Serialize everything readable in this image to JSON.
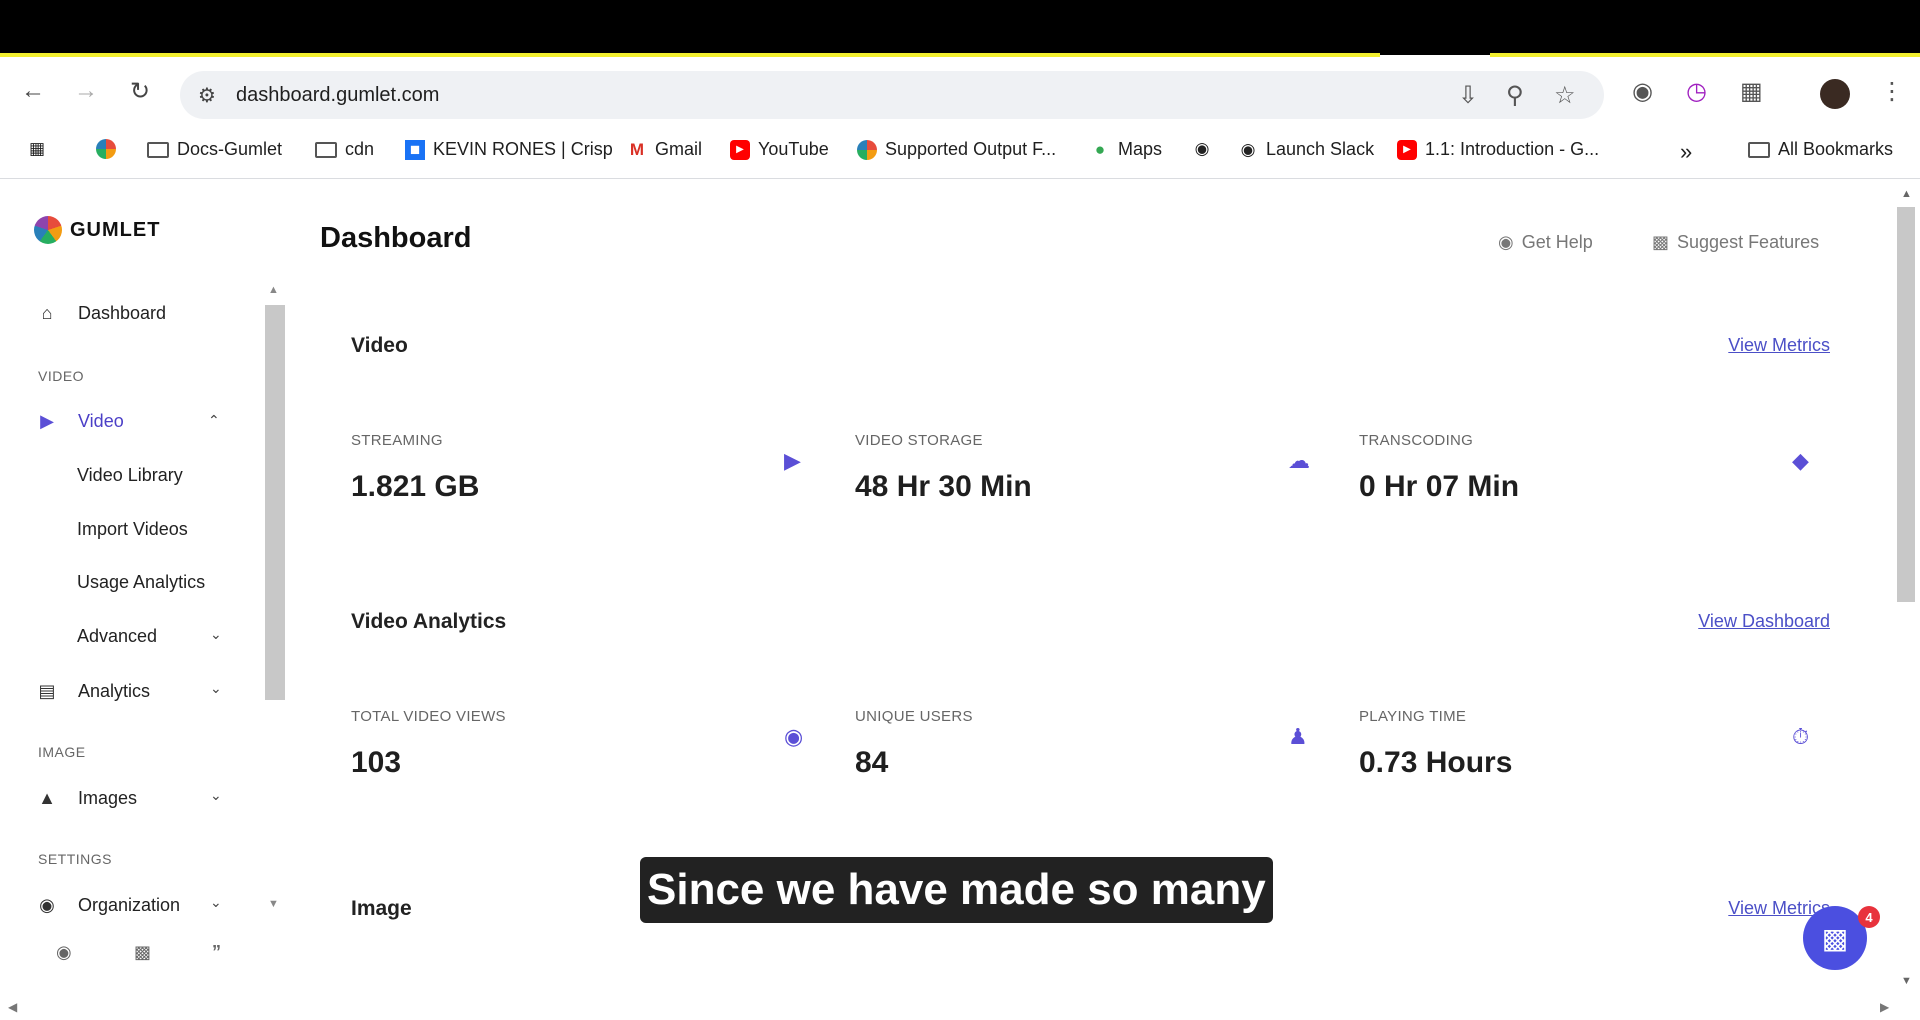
{
  "browser": {
    "url": "dashboard.gumlet.com",
    "bookmarks": [
      {
        "label": "Docs-Gumlet",
        "icon": "folder-icon"
      },
      {
        "label": "cdn",
        "icon": "folder-icon"
      },
      {
        "label": "KEVIN RONES | Crisp",
        "icon": "crisp-icon"
      },
      {
        "label": "Gmail",
        "icon": "gmail-icon"
      },
      {
        "label": "YouTube",
        "icon": "youtube-icon"
      },
      {
        "label": "Supported Output F...",
        "icon": "gumlet-icon"
      },
      {
        "label": "Maps",
        "icon": "maps-icon"
      },
      {
        "label": "Launch Slack",
        "icon": "globe-icon"
      },
      {
        "label": "1.1: Introduction - G...",
        "icon": "youtube-icon"
      }
    ],
    "all_bookmarks": "All Bookmarks"
  },
  "app": {
    "brand": "GUMLET"
  },
  "sidebar": {
    "dashboard": "Dashboard",
    "section_video": "VIDEO",
    "video": "Video",
    "video_library": "Video Library",
    "import_videos": "Import Videos",
    "usage_analytics": "Usage Analytics",
    "advanced": "Advanced",
    "analytics": "Analytics",
    "section_image": "IMAGE",
    "images": "Images",
    "section_settings": "SETTINGS",
    "organization": "Organization"
  },
  "header": {
    "title": "Dashboard",
    "get_help": "Get Help",
    "suggest_features": "Suggest Features"
  },
  "video_section": {
    "title": "Video",
    "link": "View Metrics",
    "stats": [
      {
        "label": "STREAMING",
        "value": "1.821 GB",
        "icon": "video-play-icon"
      },
      {
        "label": "VIDEO STORAGE",
        "value": "48 Hr 30 Min",
        "icon": "cloud-check-icon"
      },
      {
        "label": "TRANSCODING",
        "value": "0 Hr 07 Min",
        "icon": "layers-icon"
      }
    ]
  },
  "analytics_section": {
    "title": "Video Analytics",
    "link": "View Dashboard",
    "stats": [
      {
        "label": "TOTAL VIDEO VIEWS",
        "value": "103",
        "icon": "broadcast-icon"
      },
      {
        "label": "UNIQUE USERS",
        "value": "84",
        "icon": "users-icon"
      },
      {
        "label": "PLAYING TIME",
        "value": "0.73 Hours",
        "icon": "stopwatch-icon"
      }
    ]
  },
  "image_section": {
    "title": "Image",
    "link": "View Metrics"
  },
  "caption": "Since we have made so many",
  "chat_badge": "4",
  "colors": {
    "accent": "#5b4fd6",
    "link": "#4b4fc7",
    "caption_bg": "#222222",
    "badge": "#e8323c"
  }
}
